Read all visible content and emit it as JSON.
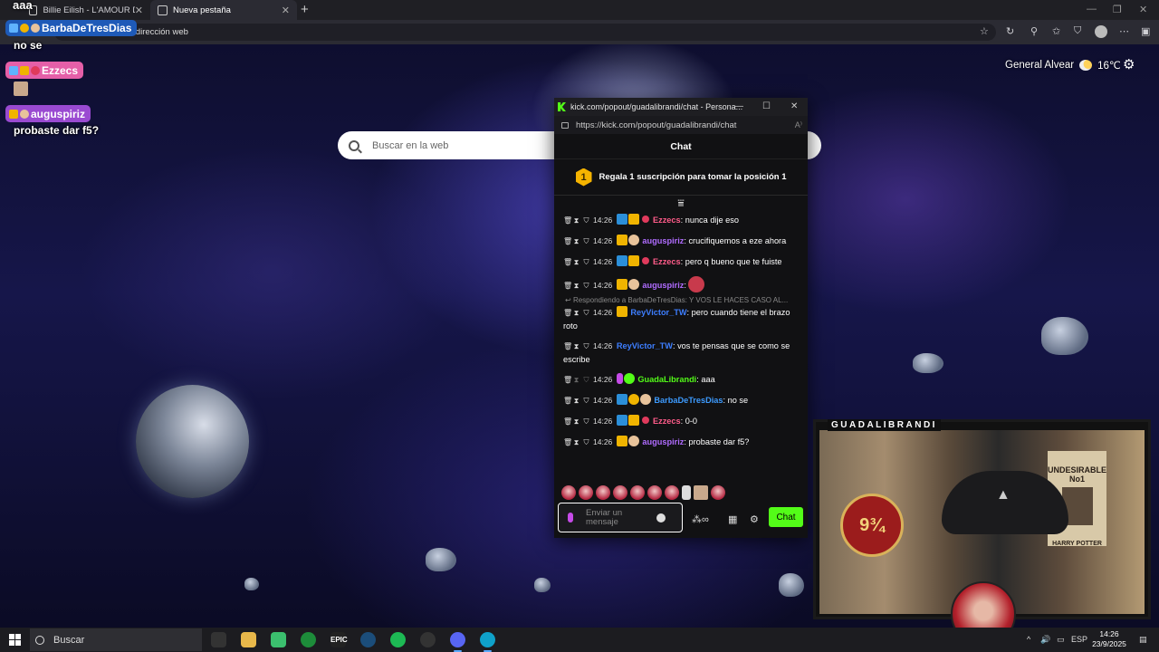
{
  "browser": {
    "tabs": [
      {
        "title": "Billie Eilish - L'AMOUR DE M",
        "active": false
      },
      {
        "title": "Nueva pestaña",
        "active": true
      }
    ],
    "address_placeholder": "r dirección web"
  },
  "overlay": {
    "top_text": "aaa",
    "user1": "BarbaDeTresDias",
    "msg1": "no se",
    "user2": "Ezzecs",
    "user3": "auguspiriz",
    "msg3": "probaste dar f5?"
  },
  "weather": {
    "location": "General Alvear",
    "temp": "16℃"
  },
  "search": {
    "placeholder": "Buscar en la web"
  },
  "kick": {
    "window_title": "kick.com/popout/guadalibrandi/chat - Persona...",
    "url": "https://kick.com/popout/guadalibrandi/chat",
    "header": "Chat",
    "gift_rank": "1",
    "gift_text": "Regala 1 suscripción para tomar la posición 1",
    "messages": [
      {
        "time": "14:26",
        "user": "Ezzecs",
        "text": ": nunca dije eso"
      },
      {
        "time": "14:26",
        "user": "auguspiriz",
        "text": ": crucifiquemos a eze ahora"
      },
      {
        "time": "14:26",
        "user": "Ezzecs",
        "text": ": pero q bueno que te fuiste"
      },
      {
        "time": "14:26",
        "user": "auguspiriz",
        "text": ":"
      },
      {
        "time": "14:26",
        "user": "ReyVictor_TW",
        "text": ": pero cuando tiene el brazo roto",
        "reply": "Respondiendo a BarbaDeTresDias: Y VOS LE HACES CASO AL..."
      },
      {
        "time": "14:26",
        "user": "ReyVictor_TW",
        "text": ": vos te pensas que se como se escribe"
      },
      {
        "time": "14:26",
        "user": "GuadaLibrandi",
        "text": ": aaa"
      },
      {
        "time": "14:26",
        "user": "BarbaDeTresDias",
        "text": ": no se"
      },
      {
        "time": "14:26",
        "user": "Ezzecs",
        "text": ": 0-0"
      },
      {
        "time": "14:26",
        "user": "auguspiriz",
        "text": ": probaste dar f5?"
      }
    ],
    "composer_placeholder": "Enviar un mensaje",
    "chat_button": "Chat"
  },
  "webcam": {
    "label": "GUADALIBRANDI",
    "poster": "UNDESIRABLE\nNo1",
    "poster_name": "HARRY POTTER",
    "platform": "9¾"
  },
  "taskbar": {
    "search": "Buscar",
    "lang": "ESP",
    "time": "14:26",
    "date": "23/9/2025"
  },
  "colors": {
    "kick_green": "#53fc18",
    "ezzecs": "#ff5c8a",
    "auguspiriz": "#b06cff",
    "reyvictor": "#3d7eff",
    "guada": "#53fc18",
    "barba": "#3d9bff"
  }
}
